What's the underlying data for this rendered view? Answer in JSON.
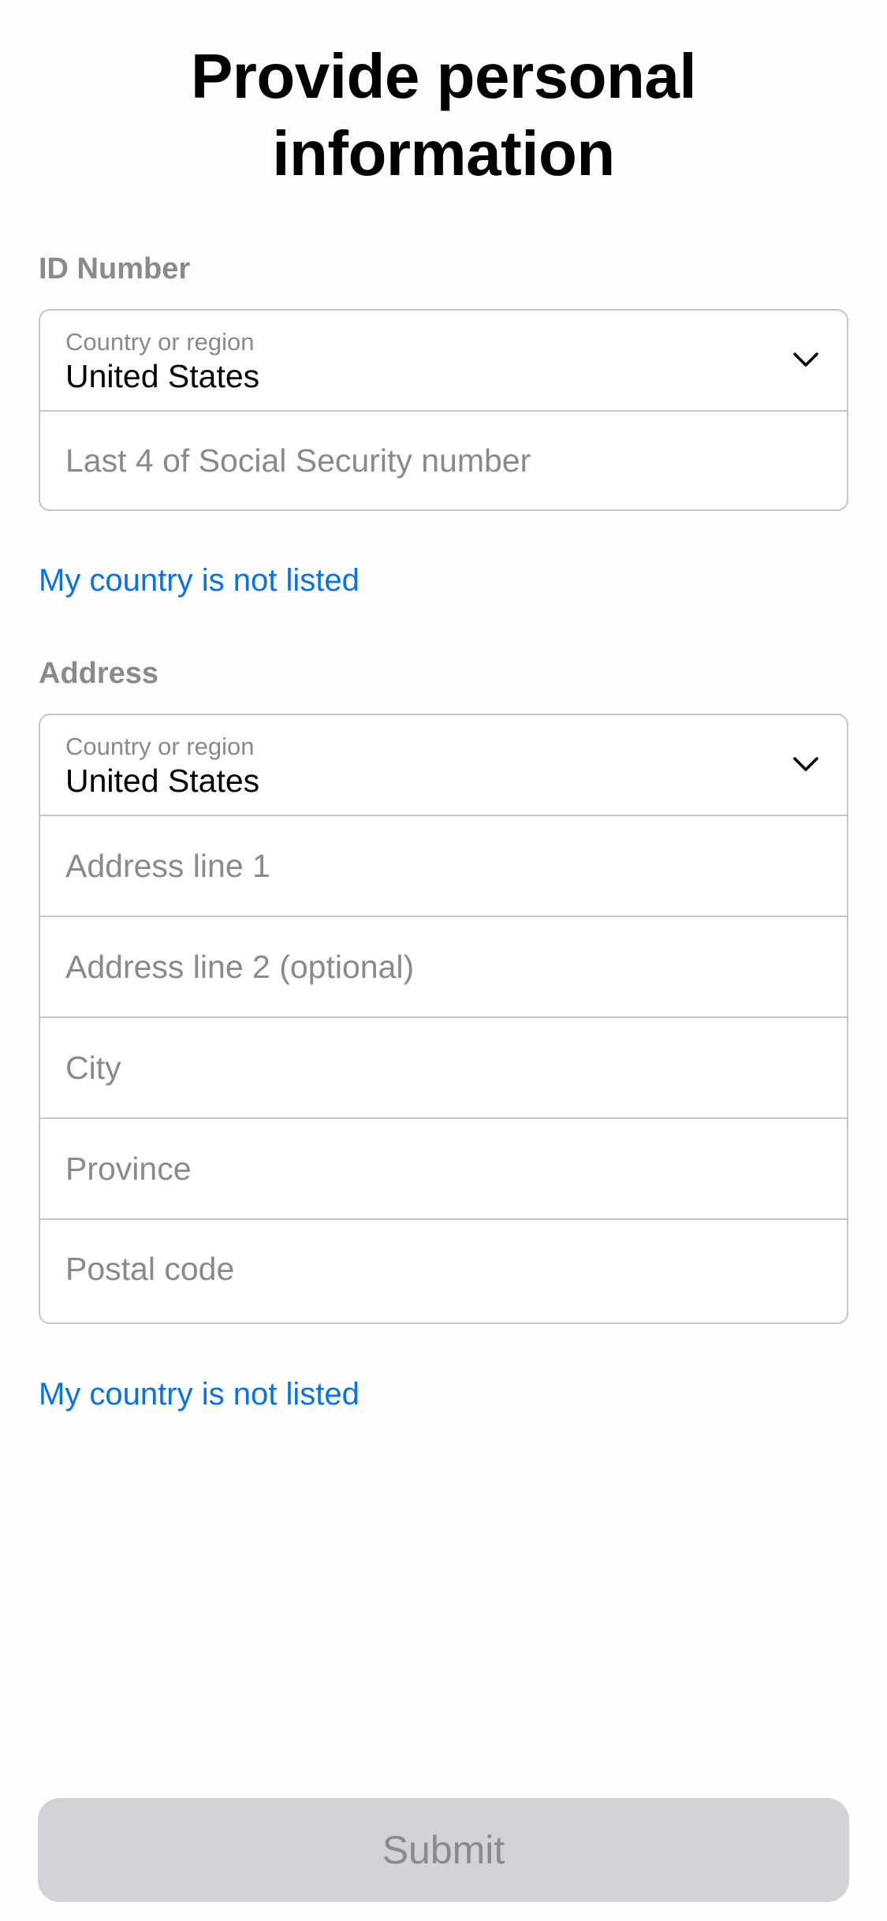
{
  "title": {
    "line1": "Provide personal",
    "line2": "information"
  },
  "id_section": {
    "label": "ID Number",
    "country_select": {
      "caption": "Country or region",
      "value": "United States"
    },
    "ssn_field": {
      "placeholder": "Last 4 of Social Security number"
    },
    "not_listed_link": "My country is not listed"
  },
  "address_section": {
    "label": "Address",
    "country_select": {
      "caption": "Country or region",
      "value": "United States"
    },
    "fields": [
      {
        "placeholder": "Address line 1"
      },
      {
        "placeholder": "Address line 2 (optional)"
      },
      {
        "placeholder": "City"
      },
      {
        "placeholder": "Province"
      },
      {
        "placeholder": "Postal code"
      }
    ],
    "not_listed_link": "My country is not listed"
  },
  "submit": {
    "label": "Submit",
    "enabled": false
  },
  "colors": {
    "link": "#0a72e6",
    "secondary_text": "#8a8a8e",
    "border": "#c6c6c8",
    "disabled_button": "#d2d2d7"
  },
  "icons": {
    "dropdown": "chevron-down-icon"
  }
}
